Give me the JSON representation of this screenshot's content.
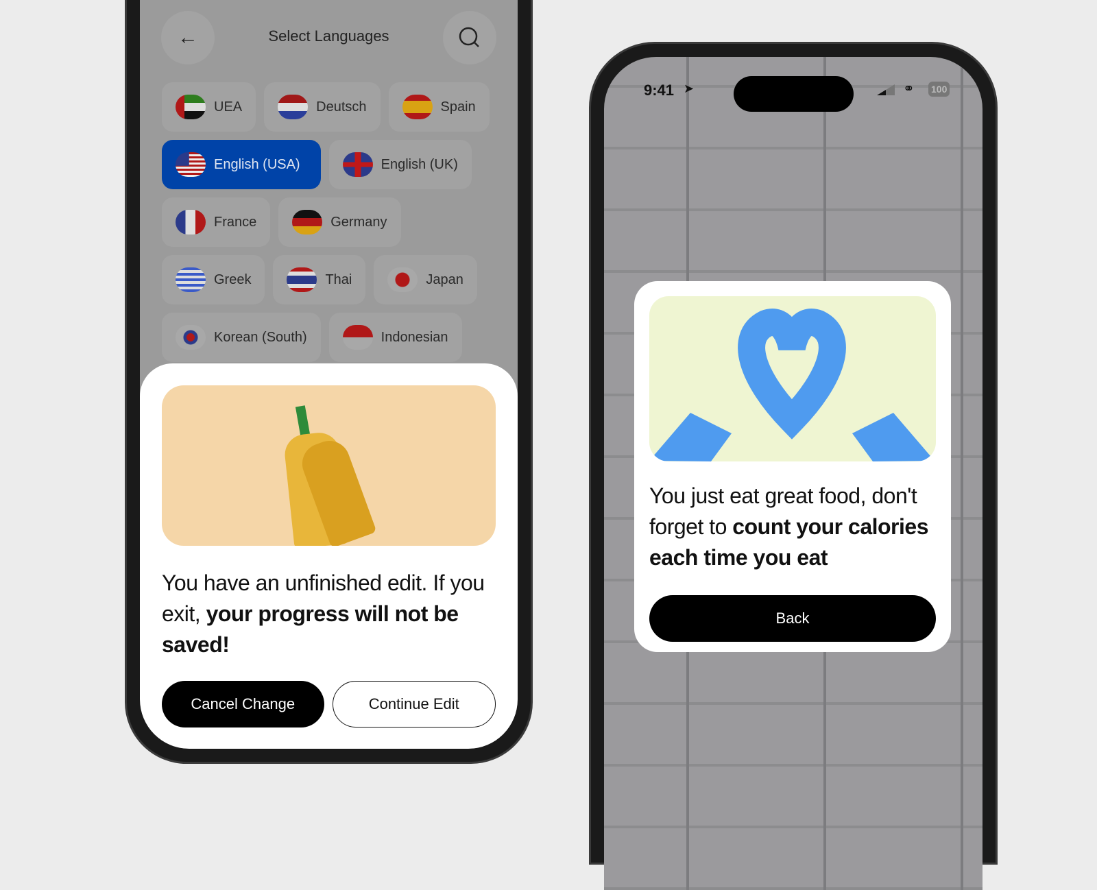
{
  "left_phone": {
    "header": {
      "title": "Select Languages",
      "back_icon": "arrow-left-icon",
      "search_icon": "search-icon"
    },
    "languages": [
      {
        "label": "UEA",
        "flag": "uae",
        "selected": false
      },
      {
        "label": "Deutsch",
        "flag": "netherlands",
        "selected": false
      },
      {
        "label": "Spain",
        "flag": "spain",
        "selected": false
      },
      {
        "label": "English (USA)",
        "flag": "usa",
        "selected": true
      },
      {
        "label": "English (UK)",
        "flag": "uk",
        "selected": false
      },
      {
        "label": "France",
        "flag": "france",
        "selected": false
      },
      {
        "label": "Germany",
        "flag": "germany",
        "selected": false
      },
      {
        "label": "Greek",
        "flag": "greece",
        "selected": false
      },
      {
        "label": "Thai",
        "flag": "thailand",
        "selected": false
      },
      {
        "label": "Japan",
        "flag": "japan",
        "selected": false
      },
      {
        "label": "Korean (South)",
        "flag": "south-korea",
        "selected": false
      },
      {
        "label": "Indonesian",
        "flag": "indonesia",
        "selected": false
      }
    ],
    "selected_color": "#0043a8",
    "sheet": {
      "message_regular": "You have an unfinished edit. If you exit, ",
      "message_bold": "your progress will not be saved!",
      "cancel_label": "Cancel Change",
      "continue_label": "Continue Edit"
    }
  },
  "right_phone": {
    "status": {
      "time": "9:41",
      "battery": "100"
    },
    "modal": {
      "message_regular": "You just eat great food, don't forget to ",
      "message_bold": "count your calories each time you eat",
      "back_label": "Back"
    }
  }
}
